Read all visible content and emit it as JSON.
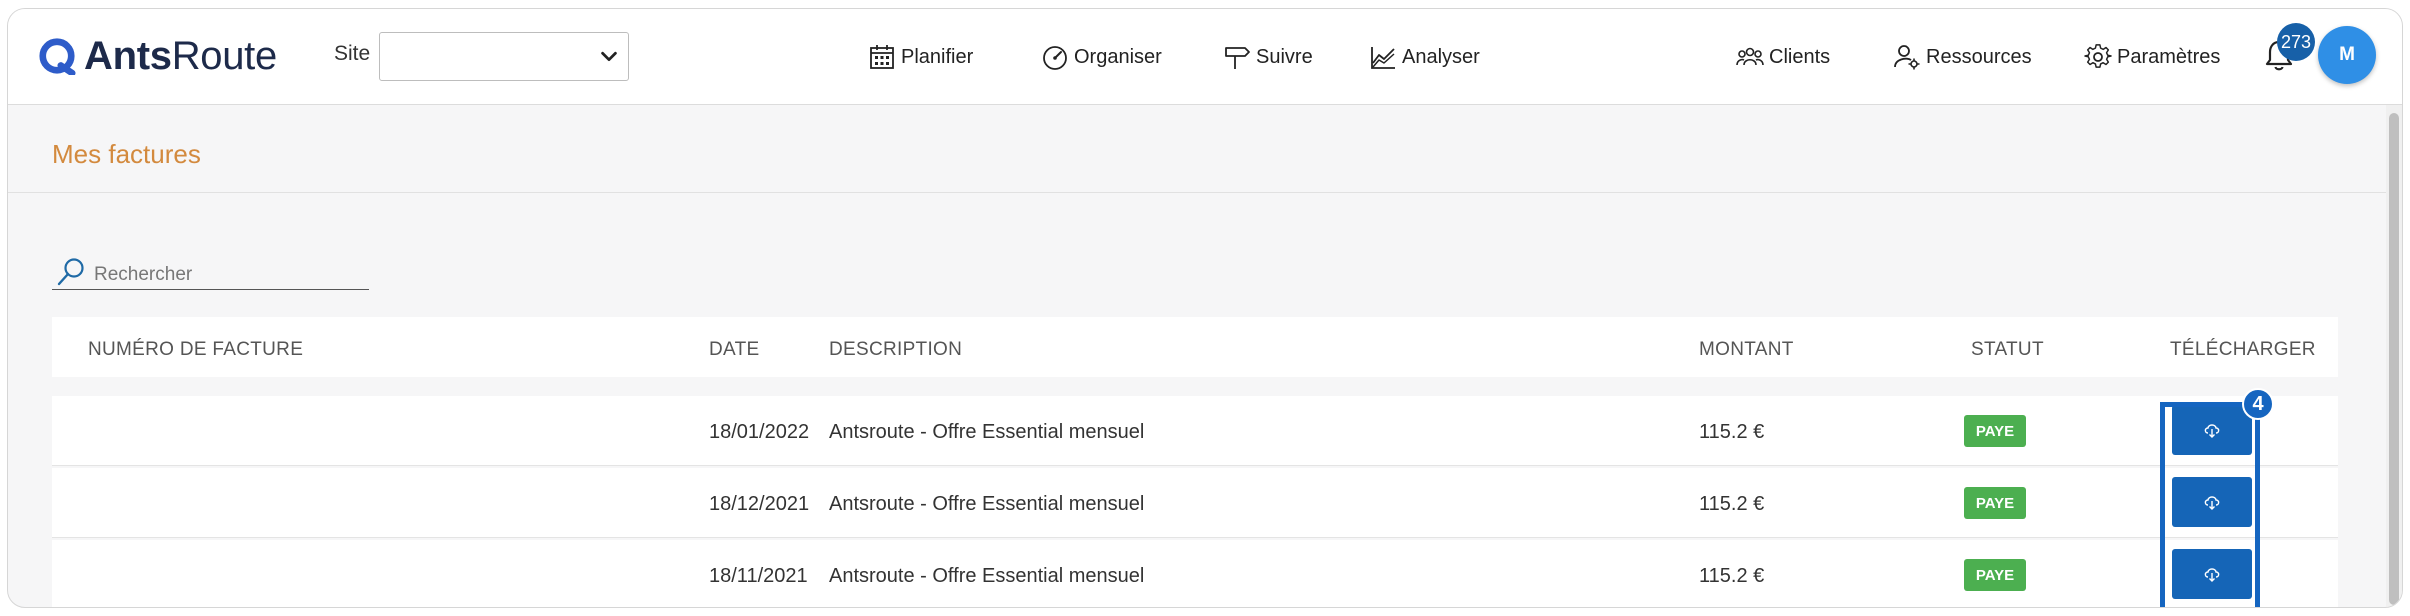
{
  "header": {
    "logo": {
      "bold": "Ants",
      "regular": "Route"
    },
    "site_label": "Site",
    "site_value": "",
    "nav": [
      {
        "label": "Planifier",
        "icon": "calendar-icon"
      },
      {
        "label": "Organiser",
        "icon": "gauge-icon"
      },
      {
        "label": "Suivre",
        "icon": "signpost-icon"
      },
      {
        "label": "Analyser",
        "icon": "chart-icon"
      }
    ],
    "right_nav": [
      {
        "label": "Clients",
        "icon": "users-icon"
      },
      {
        "label": "Ressources",
        "icon": "user-gear-icon"
      },
      {
        "label": "Paramètres",
        "icon": "gear-icon"
      }
    ],
    "notifications_count": "273",
    "avatar_initial": "M"
  },
  "page": {
    "title": "Mes factures",
    "search_placeholder": "Rechercher"
  },
  "table": {
    "columns": [
      "NUMÉRO DE FACTURE",
      "DATE",
      "DESCRIPTION",
      "MONTANT",
      "STATUT",
      "TÉLÉCHARGER"
    ],
    "rows": [
      {
        "number": "",
        "date": "18/01/2022",
        "description": "Antsroute - Offre Essential mensuel",
        "amount": "115.2 €",
        "status": "PAYE"
      },
      {
        "number": "",
        "date": "18/12/2021",
        "description": "Antsroute - Offre Essential mensuel",
        "amount": "115.2 €",
        "status": "PAYE"
      },
      {
        "number": "",
        "date": "18/11/2021",
        "description": "Antsroute - Offre Essential mensuel",
        "amount": "115.2 €",
        "status": "PAYE"
      }
    ]
  },
  "annotation": {
    "step": "4"
  },
  "colors": {
    "accent": "#d38a3e",
    "primary": "#1565b7",
    "status_paid": "#4caf50",
    "avatar": "#2f8fe6"
  }
}
